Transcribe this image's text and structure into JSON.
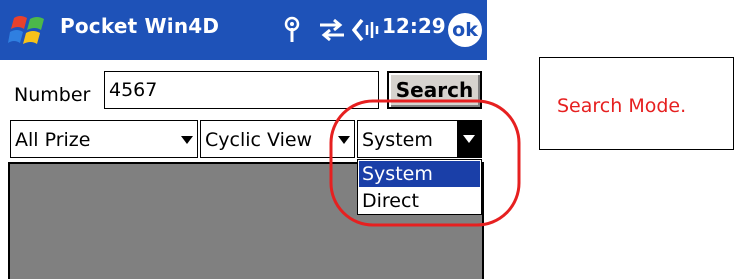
{
  "titlebar": {
    "app_title": "Pocket Win4D",
    "time": "12:29",
    "ok_label": "ok",
    "icons": [
      "windows-start-icon",
      "signal-antenna-icon",
      "sync-arrows-icon",
      "speaker-volume-icon"
    ]
  },
  "search_row": {
    "number_label": "Number",
    "number_value": "4567",
    "search_label": "Search"
  },
  "filters": {
    "prize_selected": "All Prize",
    "view_selected": "Cyclic View",
    "mode_selected": "System",
    "mode_options": [
      "System",
      "Direct"
    ]
  },
  "callout": {
    "text": "Search Mode."
  },
  "colors": {
    "titlebar": "#1e52b8",
    "selection": "#1a3fa8",
    "highlight": "#e62020",
    "panel": "#808080"
  }
}
